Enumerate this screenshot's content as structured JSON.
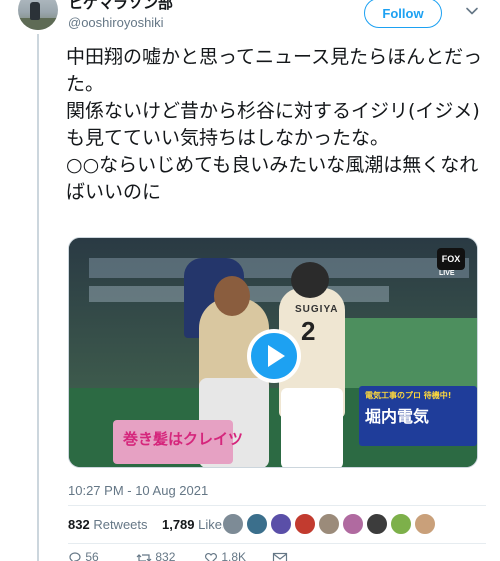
{
  "tweet": {
    "display_name": "ヒゲマラソン部",
    "handle": "@ooshiroyoshiki",
    "follow_label": "Follow",
    "text": "中田翔の嘘かと思ってニュース見たらほんとだった。\n関係ないけど昔から杉谷に対するイジリ(イジメ)も見てていい気持ちはしなかったな。\n○○ならいじめても良いみたいな風潮は無くなればいいのに",
    "timestamp": "10:27 PM - 10 Aug 2021"
  },
  "video": {
    "sign_pink": "巻き髪はクレイツ",
    "sign_blue_top": "電気工事のプロ 待機中!",
    "sign_blue_main": "堀内電気",
    "jersey_name": "SUGIYA",
    "jersey_number": "2",
    "broadcaster": "FOX",
    "live_label": "LIVE"
  },
  "stats": {
    "retweets_count": "832",
    "retweets_label": "Retweets",
    "likes_count": "1,789",
    "likes_label": "Likes"
  },
  "likers": [
    {
      "icon": "avatar-1",
      "color": "#7d8b96"
    },
    {
      "icon": "avatar-2",
      "color": "#3b6f8c"
    },
    {
      "icon": "avatar-3",
      "color": "#5a4fa8"
    },
    {
      "icon": "avatar-4",
      "color": "#c23b2f"
    },
    {
      "icon": "avatar-5",
      "color": "#9b8b7a"
    },
    {
      "icon": "avatar-6",
      "color": "#b06aa0"
    },
    {
      "icon": "avatar-7",
      "color": "#3c3c3c"
    },
    {
      "icon": "avatar-8",
      "color": "#7db04a"
    },
    {
      "icon": "avatar-9",
      "color": "#c9a07a"
    }
  ],
  "actions": {
    "reply_count": "56",
    "retweet_count": "832",
    "like_count": "1.8K"
  },
  "colors": {
    "accent": "#1da1f2",
    "secondary_text": "#657786",
    "divider": "#e6ecf0"
  }
}
